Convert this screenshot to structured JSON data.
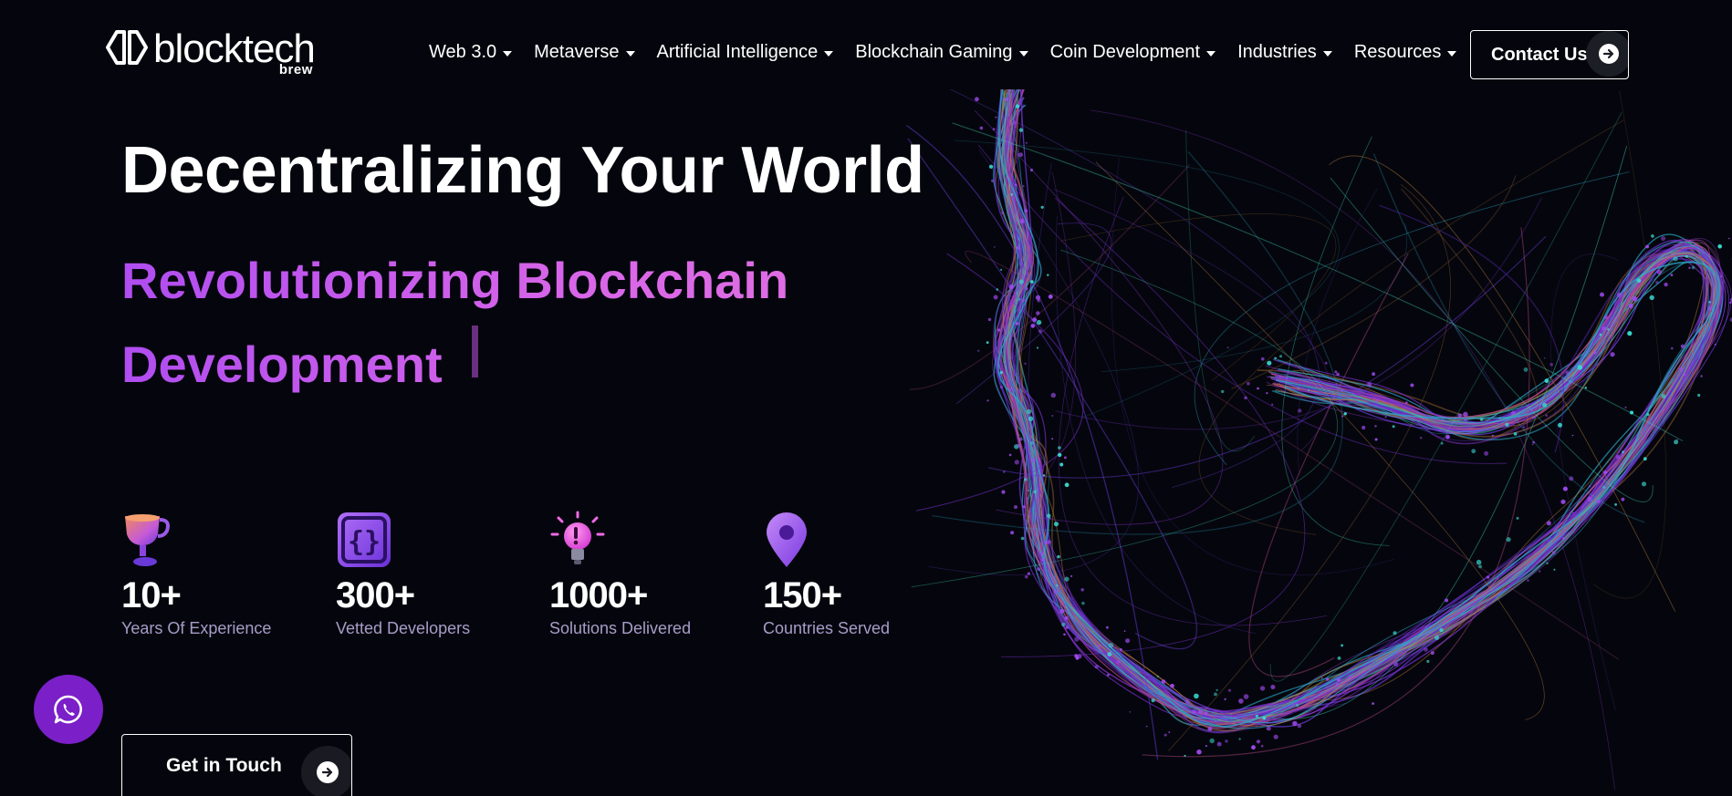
{
  "header": {
    "logo_text": "blocktech",
    "logo_sub": "brew",
    "nav": [
      {
        "label": "Web 3.0"
      },
      {
        "label": "Metaverse"
      },
      {
        "label": "Artificial Intelligence"
      },
      {
        "label": "Blockchain Gaming"
      },
      {
        "label": "Coin Development"
      },
      {
        "label": "Industries"
      },
      {
        "label": "Resources"
      }
    ],
    "contact_label": "Contact Us"
  },
  "hero": {
    "title": "Decentralizing Your World",
    "subtitle": "Revolutionizing Blockchain Development"
  },
  "stats": [
    {
      "icon": "trophy-icon",
      "value": "10+",
      "label": "Years Of Experience"
    },
    {
      "icon": "code-braces-icon",
      "value": "300+",
      "label": "Vetted Developers"
    },
    {
      "icon": "lightbulb-icon",
      "value": "1000+",
      "label": "Solutions Delivered"
    },
    {
      "icon": "location-pin-icon",
      "value": "150+",
      "label": "Countries Served"
    }
  ],
  "cta": {
    "label": "Get in Touch"
  },
  "colors": {
    "background": "#05060d",
    "accent_purple": "#b04df0",
    "accent_pink": "#e070e2",
    "whatsapp_bg": "#7b1fc8",
    "stat_label": "#a89cc8"
  }
}
